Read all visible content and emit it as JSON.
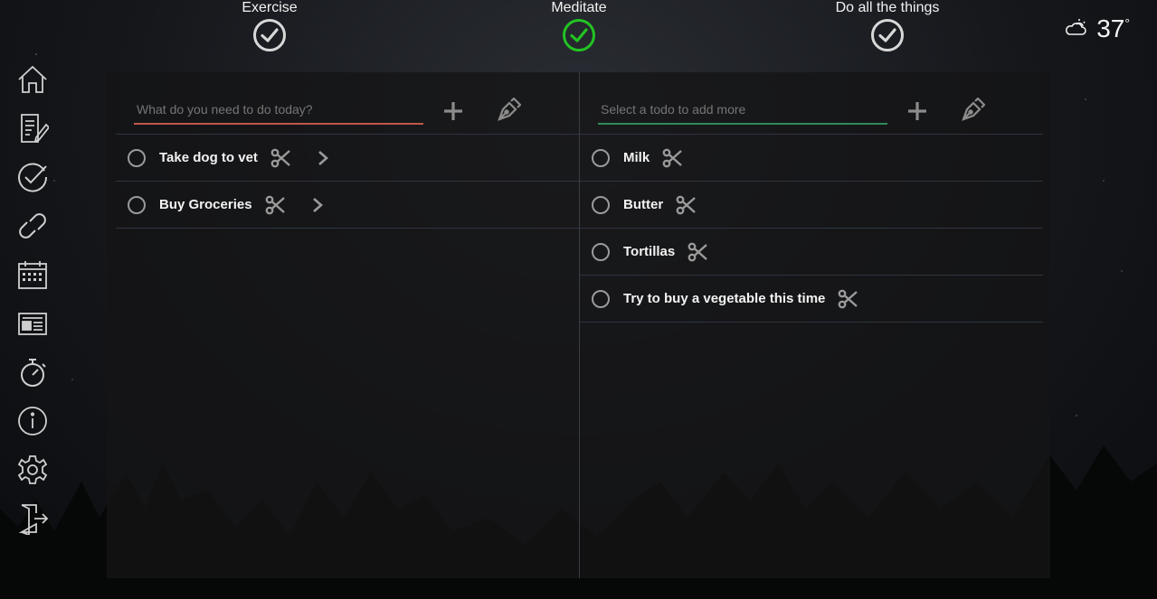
{
  "goals": [
    {
      "label": "Exercise",
      "done_color": "#d8d8d8"
    },
    {
      "label": "Meditate",
      "done_color": "#22c322"
    },
    {
      "label": "Do all the things",
      "done_color": "#d8d8d8"
    }
  ],
  "weather": {
    "temp": "37",
    "unit": "°",
    "icon": "partly-cloudy-icon"
  },
  "sidebar": {
    "icons": [
      "home-icon",
      "notes-icon",
      "check-icon",
      "link-icon",
      "calendar-icon",
      "news-icon",
      "timer-icon",
      "info-icon",
      "settings-icon",
      "exit-icon"
    ]
  },
  "todos": {
    "placeholder": "What do you need to do today?",
    "accent": "#c0574a",
    "items": [
      {
        "label": "Take dog to vet"
      },
      {
        "label": "Buy Groceries"
      }
    ]
  },
  "subtodos": {
    "placeholder": "Select a todo to add more",
    "accent": "#2e8a5a",
    "items": [
      {
        "label": "Milk"
      },
      {
        "label": "Butter"
      },
      {
        "label": "Tortillas"
      },
      {
        "label": "Try to buy a vegetable this time"
      }
    ]
  }
}
